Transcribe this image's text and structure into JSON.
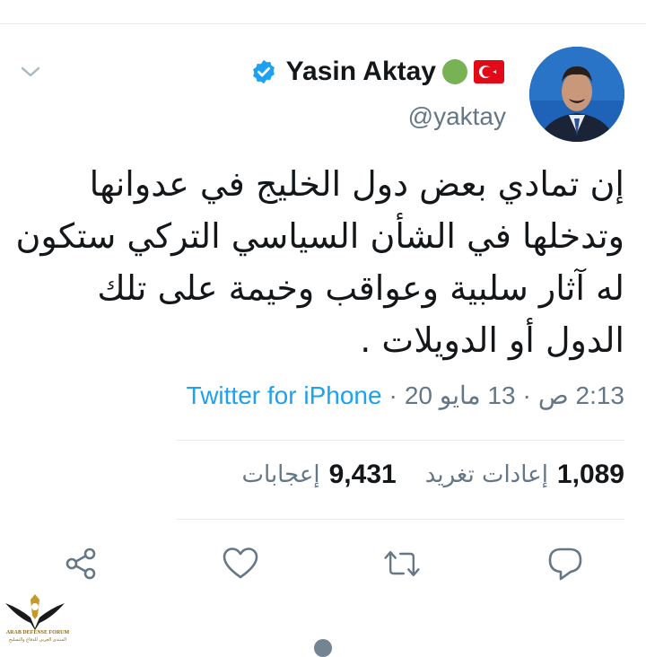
{
  "tweet": {
    "display_name": "Yasin Aktay",
    "handle": "@yaktay",
    "text_lines": [
      "إن تمادي بعض دول الخليج في عدوانها",
      "وتدخلها في الشأن  السياسي التركي ستكون",
      "له آثار سلبية وعواقب وخيمة على تلك",
      "الدول أو الدويلات ."
    ],
    "time": "2:13 ص",
    "date": "13 مايو 20",
    "separator": "·",
    "source": "Twitter for iPhone"
  },
  "stats": {
    "retweets_count": "1,089",
    "retweets_label": "إعادات تغريد",
    "likes_count": "9,431",
    "likes_label": "إعجابات"
  },
  "watermark": {
    "line1": "ARAB DEFENSE FORUM",
    "line2": "المنتدى العربي للدفاع والتسليح"
  },
  "icons": {
    "verified": "verified-badge-icon",
    "status_dot": "green-circle-icon",
    "flag": "turkey-flag-icon",
    "menu": "chevron-down-icon",
    "share": "share-icon",
    "like": "heart-icon",
    "retweet": "retweet-icon",
    "reply": "reply-icon"
  },
  "colors": {
    "accent": "#1da1f2",
    "secondary_text": "#657786",
    "divider": "#e6ecf0",
    "green_dot": "#77b255",
    "flag_red": "#e30a17"
  }
}
